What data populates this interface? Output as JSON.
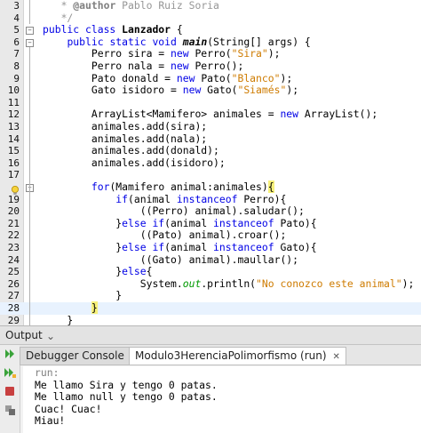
{
  "editor": {
    "lines": [
      {
        "num": "3",
        "parts": [
          {
            "t": "   * ",
            "c": "cm"
          },
          {
            "t": "@author",
            "c": "cmb"
          },
          {
            "t": " Pablo Ruiz Soria",
            "c": "cm"
          }
        ]
      },
      {
        "num": "4",
        "parts": [
          {
            "t": "   */",
            "c": "cm"
          }
        ]
      },
      {
        "num": "5",
        "parts": [
          {
            "t": "public class ",
            "c": "kw"
          },
          {
            "t": "Lanzador",
            "c": "b"
          },
          {
            "t": " {"
          }
        ]
      },
      {
        "num": "6",
        "parts": [
          {
            "t": "    "
          },
          {
            "t": "public static void ",
            "c": "kw"
          },
          {
            "t": "main",
            "c": "b it"
          },
          {
            "t": "(String[] args) {"
          }
        ]
      },
      {
        "num": "7",
        "parts": [
          {
            "t": "        Perro sira = "
          },
          {
            "t": "new ",
            "c": "kw"
          },
          {
            "t": "Perro("
          },
          {
            "t": "\"Sira\"",
            "c": "str"
          },
          {
            "t": ");"
          }
        ]
      },
      {
        "num": "8",
        "parts": [
          {
            "t": "        Perro nala = "
          },
          {
            "t": "new ",
            "c": "kw"
          },
          {
            "t": "Perro();"
          }
        ]
      },
      {
        "num": "9",
        "parts": [
          {
            "t": "        Pato donald = "
          },
          {
            "t": "new ",
            "c": "kw"
          },
          {
            "t": "Pato("
          },
          {
            "t": "\"Blanco\"",
            "c": "str"
          },
          {
            "t": ");"
          }
        ]
      },
      {
        "num": "10",
        "parts": [
          {
            "t": "        Gato isidoro = "
          },
          {
            "t": "new ",
            "c": "kw"
          },
          {
            "t": "Gato("
          },
          {
            "t": "\"Siamés\"",
            "c": "str"
          },
          {
            "t": ");"
          }
        ]
      },
      {
        "num": "11",
        "parts": [
          {
            "t": ""
          }
        ]
      },
      {
        "num": "12",
        "parts": [
          {
            "t": "        ArrayList<Mamifero> animales = "
          },
          {
            "t": "new ",
            "c": "kw"
          },
          {
            "t": "ArrayList();"
          }
        ]
      },
      {
        "num": "13",
        "parts": [
          {
            "t": "        animales.add(sira);"
          }
        ]
      },
      {
        "num": "14",
        "parts": [
          {
            "t": "        animales.add(nala);"
          }
        ]
      },
      {
        "num": "15",
        "parts": [
          {
            "t": "        animales.add(donald);"
          }
        ]
      },
      {
        "num": "16",
        "parts": [
          {
            "t": "        animales.add(isidoro);"
          }
        ]
      },
      {
        "num": "17",
        "parts": [
          {
            "t": ""
          }
        ]
      },
      {
        "num": "",
        "parts": [
          {
            "t": "        "
          },
          {
            "t": "for",
            "c": "kw"
          },
          {
            "t": "(Mamifero animal:animales)"
          },
          {
            "t": "{",
            "c": "brace"
          }
        ]
      },
      {
        "num": "19",
        "parts": [
          {
            "t": "            "
          },
          {
            "t": "if",
            "c": "kw"
          },
          {
            "t": "(animal "
          },
          {
            "t": "instanceof",
            "c": "kw"
          },
          {
            "t": " Perro){"
          }
        ]
      },
      {
        "num": "20",
        "parts": [
          {
            "t": "                ((Perro) animal).saludar();"
          }
        ]
      },
      {
        "num": "21",
        "parts": [
          {
            "t": "            }"
          },
          {
            "t": "else if",
            "c": "kw"
          },
          {
            "t": "(animal "
          },
          {
            "t": "instanceof",
            "c": "kw"
          },
          {
            "t": " Pato){"
          }
        ]
      },
      {
        "num": "22",
        "parts": [
          {
            "t": "                ((Pato) animal).croar();"
          }
        ]
      },
      {
        "num": "23",
        "parts": [
          {
            "t": "            }"
          },
          {
            "t": "else if",
            "c": "kw"
          },
          {
            "t": "(animal "
          },
          {
            "t": "instanceof",
            "c": "kw"
          },
          {
            "t": " Gato){"
          }
        ]
      },
      {
        "num": "24",
        "parts": [
          {
            "t": "                ((Gato) animal).maullar();"
          }
        ]
      },
      {
        "num": "25",
        "parts": [
          {
            "t": "            }"
          },
          {
            "t": "else",
            "c": "kw"
          },
          {
            "t": "{"
          }
        ]
      },
      {
        "num": "26",
        "parts": [
          {
            "t": "                System."
          },
          {
            "t": "out",
            "c": "fld"
          },
          {
            "t": ".println("
          },
          {
            "t": "\"No conozco este animal\"",
            "c": "str"
          },
          {
            "t": ");"
          }
        ]
      },
      {
        "num": "27",
        "parts": [
          {
            "t": "            }"
          }
        ]
      },
      {
        "num": "28",
        "parts": [
          {
            "t": "        "
          },
          {
            "t": "}",
            "c": "brace"
          }
        ]
      },
      {
        "num": "29",
        "parts": [
          {
            "t": "    }"
          }
        ]
      }
    ]
  },
  "output": {
    "title": "Output",
    "minimize_glyph": "⌄",
    "tabs": [
      {
        "label": "Debugger Console"
      },
      {
        "label": "Modulo3HerenciaPolimorfismo (run)"
      }
    ],
    "tab_close_glyph": "✕",
    "console_lines": [
      "run:",
      "Me llamo Sira y tengo 0 patas.",
      "Me llamo null y tengo 0 patas.",
      "Cuac! Cuac!",
      "Miau!"
    ]
  },
  "colors": {
    "keyword": "#0000e6",
    "string": "#ce7b00",
    "comment": "#969696",
    "current_line": "#e8f2fe",
    "brace_highlight": "#f7f17b"
  },
  "icons": [
    "fold-toggle-icon",
    "lightbulb-hint-icon",
    "rerun-icon",
    "rerun-different-icon",
    "stop-icon",
    "settings-icon"
  ]
}
